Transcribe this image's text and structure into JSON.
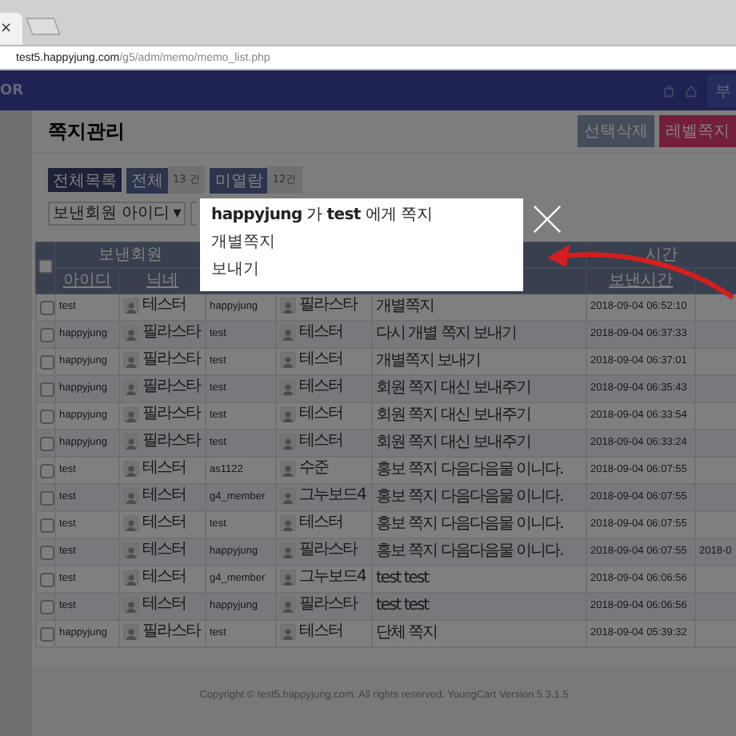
{
  "browser": {
    "tab_close": "×",
    "url_host": "test5.happyjung.com",
    "url_path": "/g5/adm/memo/memo_list.php"
  },
  "navbar": {
    "logo": "OR",
    "button": "부"
  },
  "page_title": "쪽지관리",
  "header_buttons": [
    {
      "label": "선택삭제",
      "kind": "secondary"
    },
    {
      "label": "레벨쪽지",
      "kind": "primary"
    }
  ],
  "filters": {
    "all_button": "전체목록",
    "counts": [
      {
        "label": "전체",
        "value": "13 건"
      },
      {
        "label": "미열람",
        "value": "12건"
      }
    ],
    "select": "보낸회원 아이디",
    "select_caret": "▾"
  },
  "table": {
    "select_all_checked": false,
    "group_headers": [
      "보낸회원",
      "시간"
    ],
    "columns": [
      "아이디",
      "닉네",
      "보낸시간"
    ],
    "rows": [
      {
        "checked": false,
        "sender_id": "test",
        "sender_nick": "테스터",
        "recipient_id": "happyjung",
        "recipient_nick": "필라스타",
        "content": "개별쪽지",
        "sent": "2018-09-04 06:52:10"
      },
      {
        "checked": false,
        "sender_id": "happyjung",
        "sender_nick": "필라스타",
        "recipient_id": "test",
        "recipient_nick": "테스터",
        "content": "다시 개별 쪽지 보내기",
        "sent": "2018-09-04 06:37:33"
      },
      {
        "checked": false,
        "sender_id": "happyjung",
        "sender_nick": "필라스타",
        "recipient_id": "test",
        "recipient_nick": "테스터",
        "content": "개별쪽지 보내기",
        "sent": "2018-09-04 06:37:01"
      },
      {
        "checked": false,
        "sender_id": "happyjung",
        "sender_nick": "필라스타",
        "recipient_id": "test",
        "recipient_nick": "테스터",
        "content": "회원 쪽지 대신 보내주기",
        "sent": "2018-09-04 06:35:43"
      },
      {
        "checked": false,
        "sender_id": "happyjung",
        "sender_nick": "필라스타",
        "recipient_id": "test",
        "recipient_nick": "테스터",
        "content": "회원 쪽지 대신 보내주기",
        "sent": "2018-09-04 06:33:54"
      },
      {
        "checked": false,
        "sender_id": "happyjung",
        "sender_nick": "필라스타",
        "recipient_id": "test",
        "recipient_nick": "테스터",
        "content": "회원 쪽지 대신 보내주기",
        "sent": "2018-09-04 06:33:24"
      },
      {
        "checked": false,
        "sender_id": "test",
        "sender_nick": "테스터",
        "recipient_id": "as1122",
        "recipient_nick": "수준",
        "content": "홍보 쪽지 다음다음물 이니다.",
        "sent": "2018-09-04 06:07:55"
      },
      {
        "checked": false,
        "sender_id": "test",
        "sender_nick": "테스터",
        "recipient_id": "g4_member",
        "recipient_nick": "그누보드4",
        "content": "홍보 쪽지 다음다음물 이니다.",
        "sent": "2018-09-04 06:07:55"
      },
      {
        "checked": false,
        "sender_id": "test",
        "sender_nick": "테스터",
        "recipient_id": "test",
        "recipient_nick": "테스터",
        "content": "홍보 쪽지 다음다음물 이니다.",
        "sent": "2018-09-04 06:07:55"
      },
      {
        "checked": false,
        "sender_id": "test",
        "sender_nick": "테스터",
        "recipient_id": "happyjung",
        "recipient_nick": "필라스타",
        "content": "홍보 쪽지 다음다음물 이니다.",
        "sent": "2018-09-04 06:07:55",
        "read": "2018-0"
      },
      {
        "checked": false,
        "sender_id": "test",
        "sender_nick": "테스터",
        "recipient_id": "g4_member",
        "recipient_nick": "그누보드4",
        "content": "test test",
        "sent": "2018-09-04 06:06:56"
      },
      {
        "checked": false,
        "sender_id": "test",
        "sender_nick": "테스터",
        "recipient_id": "happyjung",
        "recipient_nick": "필라스타",
        "content": "test test",
        "sent": "2018-09-04 06:06:56"
      },
      {
        "checked": false,
        "sender_id": "happyjung",
        "sender_nick": "필라스타",
        "recipient_id": "test",
        "recipient_nick": "테스터",
        "content": "단체 쪽지",
        "sent": "2018-09-04 05:39:32"
      }
    ]
  },
  "footer": "Copyright © test5.happyjung.com. All rights reserved. YoungCart Version 5.3.1.5",
  "modal": {
    "title": "**happyjung** 가 **test** 에게 쪽지",
    "label": "개별쪽지",
    "send": "보내기"
  }
}
